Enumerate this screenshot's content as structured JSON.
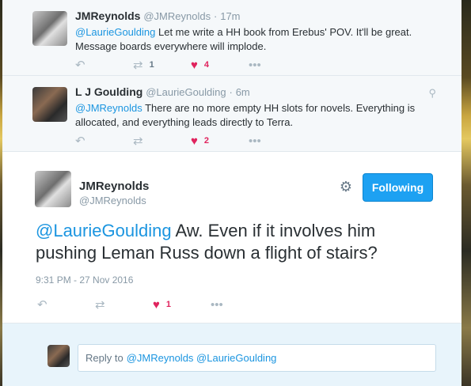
{
  "tweets": [
    {
      "fullname": "JMReynolds",
      "screenname": "@JMReynolds",
      "sep": "·",
      "time": "17m",
      "mention": "@LaurieGoulding",
      "text": " Let me write a HH book from Erebus' POV. It'll be great. Message boards everywhere will implode.",
      "retweets": "1",
      "likes": "4"
    },
    {
      "fullname": "L J Goulding",
      "screenname": "@LaurieGoulding",
      "sep": "·",
      "time": "6m",
      "mention": "@JMReynolds",
      "text": " There are no more empty HH slots for novels. Everything is allocated, and everything leads directly to Terra.",
      "retweets": "",
      "likes": "2"
    }
  ],
  "permalink": {
    "fullname": "JMReynolds",
    "screenname": "@JMReynolds",
    "follow_label": "Following",
    "mention": "@LaurieGoulding",
    "text": " Aw. Even if it involves him pushing Leman Russ down a flight of stairs?",
    "timestamp": "9:31 PM - 27 Nov 2016",
    "likes": "1"
  },
  "reply": {
    "prefix": "Reply to",
    "mentions": "@JMReynolds @LaurieGoulding"
  },
  "icons": {
    "reply": "reply-icon",
    "retweet": "retweet-icon",
    "like": "heart-icon",
    "more": "more-icon",
    "gear": "gear-icon",
    "geo": "location-pin-icon"
  },
  "colors": {
    "link": "#1b95e0",
    "like": "#e0245e",
    "follow_button": "#1da1f2"
  }
}
